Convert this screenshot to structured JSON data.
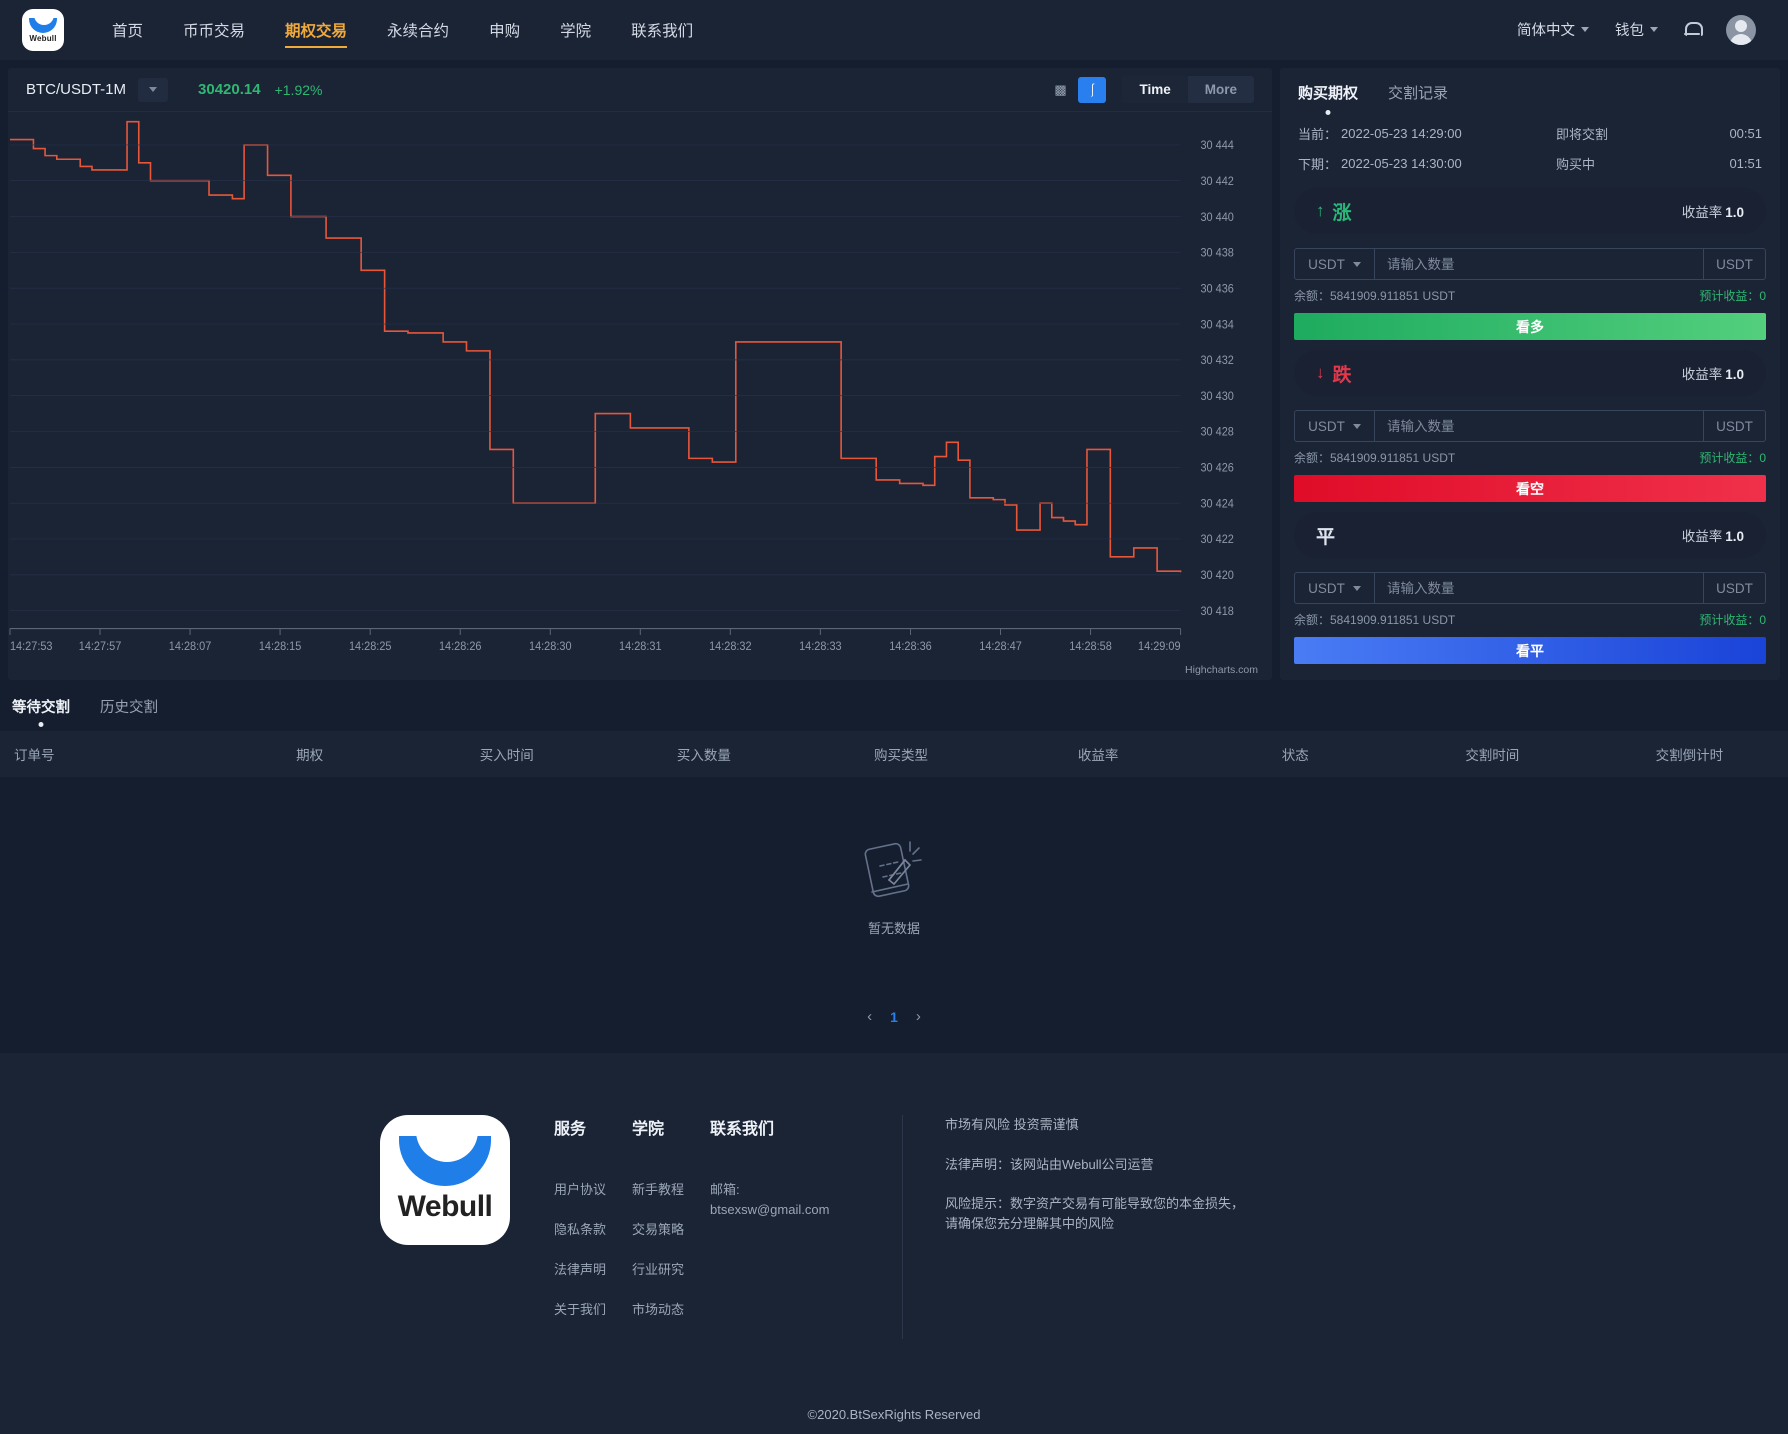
{
  "nav": {
    "brand": "Webull",
    "links": [
      {
        "label": "首页",
        "active": false
      },
      {
        "label": "币币交易",
        "active": false
      },
      {
        "label": "期权交易",
        "active": true
      },
      {
        "label": "永续合约",
        "active": false
      },
      {
        "label": "申购",
        "active": false
      },
      {
        "label": "学院",
        "active": false
      },
      {
        "label": "联系我们",
        "active": false
      }
    ],
    "language": "简体中文",
    "wallet": "钱包"
  },
  "chart_head": {
    "pair": "BTC/USDT-1M",
    "price": "30420.14",
    "change": "+1.92%",
    "tools": {
      "candle_icon": "candlestick-icon",
      "depth_icon": "depth-icon",
      "time_btn": "Time",
      "more_btn": "More"
    }
  },
  "chart_data": {
    "type": "line",
    "title": "BTC/USDT-1M",
    "credit": "Highcharts.com",
    "xlabel": "",
    "ylabel": "",
    "line_color": "#e8563a",
    "ylim": [
      30417,
      30445
    ],
    "y_ticks": [
      "30 444",
      "30 442",
      "30 440",
      "30 438",
      "30 436",
      "30 434",
      "30 432",
      "30 430",
      "30 428",
      "30 426",
      "30 424",
      "30 422",
      "30 420",
      "30 418"
    ],
    "x_ticks": [
      "14:27:53",
      "14:27:57",
      "14:28:07",
      "14:28:15",
      "14:28:25",
      "14:28:26",
      "14:28:30",
      "14:28:31",
      "14:28:32",
      "14:28:33",
      "14:28:36",
      "14:28:47",
      "14:28:58",
      "14:29:09"
    ],
    "x": [
      0,
      1,
      2,
      3,
      4,
      5,
      6,
      7,
      8,
      9,
      10,
      11,
      12,
      13,
      14,
      15,
      16,
      17,
      18,
      19,
      20,
      21,
      22,
      23,
      24,
      25,
      26,
      27,
      28,
      29,
      30,
      31,
      32,
      33,
      34,
      35,
      36,
      37,
      38,
      39,
      40,
      41,
      42,
      43,
      44,
      45,
      46,
      47,
      48,
      49,
      50,
      51,
      52,
      53,
      54,
      55,
      56,
      57,
      58,
      59,
      60,
      61,
      62,
      63,
      64,
      65,
      66,
      67,
      68,
      69,
      70,
      71,
      72,
      73,
      74,
      75,
      76,
      77,
      78,
      79,
      80,
      81,
      82,
      83,
      84,
      85,
      86,
      87,
      88,
      89,
      90,
      91,
      92,
      93,
      94,
      95,
      96,
      97,
      98,
      99,
      100
    ],
    "values": [
      30444.3,
      30444.3,
      30443.8,
      30443.4,
      30443.2,
      30443.2,
      30442.8,
      30442.6,
      30442.6,
      30442.6,
      30445.3,
      30443.0,
      30442.0,
      30442.0,
      30442.0,
      30442.0,
      30442.0,
      30441.2,
      30441.2,
      30441.0,
      30444.0,
      30444.0,
      30442.3,
      30442.3,
      30440.0,
      30440.0,
      30440.0,
      30438.8,
      30438.8,
      30438.8,
      30437.0,
      30437.0,
      30433.6,
      30433.6,
      30433.5,
      30433.5,
      30433.5,
      30433.0,
      30433.0,
      30432.5,
      30432.5,
      30427.0,
      30427.0,
      30424.0,
      30424.0,
      30424.0,
      30424.0,
      30424.0,
      30424.0,
      30424.0,
      30429.0,
      30429.0,
      30429.0,
      30428.2,
      30428.2,
      30428.2,
      30428.2,
      30428.2,
      30426.5,
      30426.5,
      30426.3,
      30426.3,
      30433.0,
      30433.0,
      30433.0,
      30433.0,
      30433.0,
      30433.0,
      30433.0,
      30433.0,
      30433.0,
      30426.5,
      30426.5,
      30426.5,
      30425.3,
      30425.3,
      30425.1,
      30425.1,
      30425.0,
      30426.6,
      30427.4,
      30426.4,
      30424.3,
      30424.3,
      30424.2,
      30423.9,
      30422.5,
      30422.5,
      30424.0,
      30423.2,
      30423.0,
      30422.8,
      30427.0,
      30427.0,
      30421.0,
      30421.0,
      30421.5,
      30421.5,
      30420.2,
      30420.2,
      30420.14
    ]
  },
  "trade": {
    "tabs": [
      {
        "label": "购买期权",
        "active": true
      },
      {
        "label": "交割记录",
        "active": false
      }
    ],
    "info": [
      {
        "label": "当前：",
        "datetime": "2022-05-23 14:29:00",
        "status": "即将交割",
        "countdown": "00:51"
      },
      {
        "label": "下期：",
        "datetime": "2022-05-23 14:30:00",
        "status": "购买中",
        "countdown": "01:51"
      }
    ],
    "options": [
      {
        "icon": "arrow-up-icon",
        "arrow": "↑",
        "name": "涨",
        "rate_label": "收益率",
        "rate_value": "1.0",
        "currency": "USDT",
        "placeholder": "请输入数量",
        "value": "",
        "unit": "USDT",
        "balance": "余额：5841909.911851 USDT",
        "estimate": "预计收益：0",
        "button": "看多",
        "kind": "up"
      },
      {
        "icon": "arrow-down-icon",
        "arrow": "↓",
        "name": "跌",
        "rate_label": "收益率",
        "rate_value": "1.0",
        "currency": "USDT",
        "placeholder": "请输入数量",
        "value": "",
        "unit": "USDT",
        "balance": "余额：5841909.911851 USDT",
        "estimate": "预计收益：0",
        "button": "看空",
        "kind": "down"
      },
      {
        "icon": "flat-icon",
        "arrow": "",
        "name": "平",
        "rate_label": "收益率",
        "rate_value": "1.0",
        "currency": "USDT",
        "placeholder": "请输入数量",
        "value": "",
        "unit": "USDT",
        "balance": "余额：5841909.911851 USDT",
        "estimate": "预计收益：0",
        "button": "看平",
        "kind": "flat"
      }
    ]
  },
  "orders": {
    "tabs": [
      {
        "label": "等待交割",
        "active": true
      },
      {
        "label": "历史交割",
        "active": false
      }
    ],
    "columns": [
      "订单号",
      "期权",
      "买入时间",
      "买入数量",
      "购买类型",
      "收益率",
      "状态",
      "交割时间",
      "交割倒计时"
    ],
    "rows": [],
    "empty_text": "暂无数据",
    "pagination": {
      "prev": "‹",
      "page": "1",
      "next": "›"
    }
  },
  "footer": {
    "columns": [
      {
        "title": "服务",
        "links": [
          "用户协议",
          "隐私条款",
          "法律声明",
          "关于我们"
        ]
      },
      {
        "title": "学院",
        "links": [
          "新手教程",
          "交易策略",
          "行业研究",
          "市场动态"
        ]
      },
      {
        "title": "联系我们",
        "links": [
          "邮箱:",
          "btsexsw@gmail.com"
        ]
      }
    ],
    "disclaimers": [
      "市场有风险 投资需谨慎",
      "法律声明：该网站由Webull公司运营",
      "风险提示：数字资产交易有可能导致您的本金损失，请确保您充分理解其中的风险"
    ],
    "copyright": "©2020.BtSexRights Reserved"
  }
}
